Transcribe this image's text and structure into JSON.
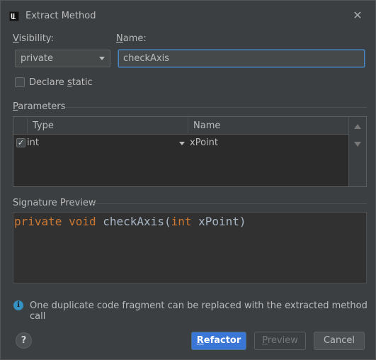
{
  "window": {
    "title": "Extract Method",
    "app_icon": "intellij-idea-icon",
    "close_glyph": "✕"
  },
  "visibility": {
    "label": "Visibility:",
    "mnemonic": "V",
    "rest": "isibility:",
    "selected": "private"
  },
  "name": {
    "label": "Name:",
    "mnemonic": "N",
    "rest": "ame:",
    "value": "checkAxis"
  },
  "declare_static": {
    "prefix": "Declare ",
    "mnemonic": "s",
    "rest": "tatic",
    "checked": false
  },
  "parameters": {
    "section_label_mnemonic": "P",
    "section_label_rest": "arameters",
    "columns": [
      "Type",
      "Name"
    ],
    "rows": [
      {
        "checked": true,
        "check_glyph": "✓",
        "type": "int",
        "name": "xPoint"
      }
    ]
  },
  "signature_preview": {
    "label": "Signature Preview",
    "kw1": "private",
    "kw2": "void",
    "method": "checkAxis(",
    "kw3": "int",
    "rest": "xPoint)"
  },
  "info": {
    "icon": "info-icon",
    "glyph": "i",
    "text": "One duplicate code fragment can be replaced with the extracted method call"
  },
  "buttons": {
    "help": "?",
    "refactor_mnemonic": "R",
    "refactor_rest": "efactor",
    "preview_mnemonic": "P",
    "preview_rest": "review",
    "cancel": "Cancel"
  },
  "colors": {
    "background": "#3c3f41",
    "accent": "#3a76d6",
    "keyword": "#cc7832",
    "info": "#3592c4"
  }
}
